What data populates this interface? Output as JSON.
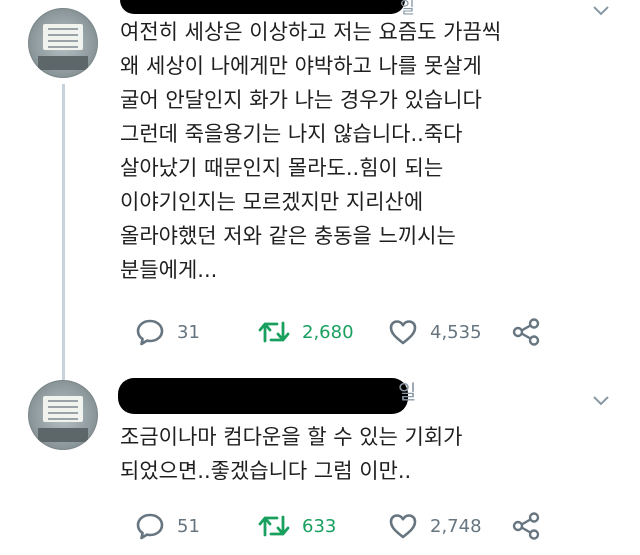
{
  "tweets": [
    {
      "header_fragment": "일",
      "text_lines": [
        "여전히 세상은 이상하고 저는 요즘도 가끔씩",
        "왜 세상이 나에게만 야박하고 나를 못살게",
        "굴어 안달인지 화가 나는 경우가 있습니다",
        "그런데 죽을용기는 나지 않습니다..죽다",
        "살아났기 때문인지 몰라도..힘이 되는",
        "이야기인지는 모르겠지만 지리산에",
        "올라야했던 저와 같은 충동을 느끼시는",
        "분들에게..."
      ],
      "replies": "31",
      "retweets": "2,680",
      "likes": "4,535"
    },
    {
      "header_fragment": "일",
      "text_lines": [
        "조금이나마 컴다운을 할 수 있는 기회가",
        "되었으면..좋겠습니다 그럼 이만.."
      ],
      "replies": "51",
      "retweets": "633",
      "likes": "2,748"
    }
  ],
  "icons": {
    "reply": "reply-bubble-icon",
    "retweet": "retweet-arrows-icon",
    "like": "heart-icon",
    "share": "share-nodes-icon",
    "more": "chevron-down-icon"
  },
  "colors": {
    "text": "#1f1f1f",
    "muted": "#66757f",
    "retweet_green": "#19a05f",
    "thread_line": "#c8d2da",
    "redaction": "#000000"
  }
}
